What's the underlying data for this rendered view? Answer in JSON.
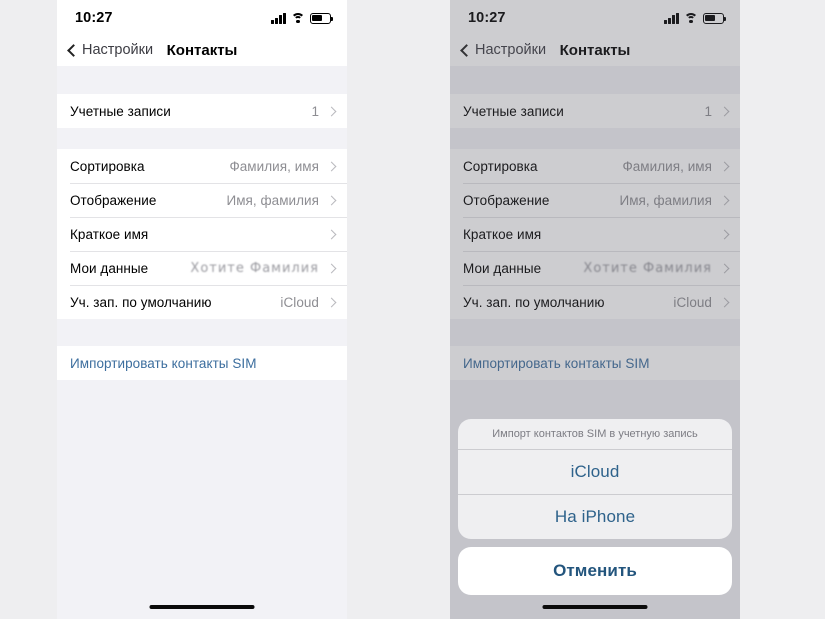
{
  "panels": [
    {
      "id": "left",
      "dimmed": false,
      "status_bar": {
        "time": "10:27",
        "signal_icon": "cellular-signal-icon",
        "wifi_icon": "wifi-icon",
        "battery_icon": "battery-icon"
      },
      "nav": {
        "back_label": "Настройки",
        "back_icon": "chevron-left-icon",
        "title": "Контакты"
      },
      "groups": [
        {
          "rows": [
            {
              "label": "Учетные записи",
              "value": "1",
              "type": "disclosure"
            }
          ]
        },
        {
          "rows": [
            {
              "label": "Сортировка",
              "value": "Фамилия, имя",
              "type": "disclosure"
            },
            {
              "label": "Отображение",
              "value": "Имя, фамилия",
              "type": "disclosure"
            },
            {
              "label": "Краткое имя",
              "value": "",
              "type": "disclosure"
            },
            {
              "label": "Мои данные",
              "value": "Хотите Фамилия",
              "type": "redacted"
            },
            {
              "label": "Уч. зап. по умолчанию",
              "value": "iCloud",
              "type": "disclosure"
            }
          ]
        },
        {
          "rows": [
            {
              "label": "Импортировать контакты SIM",
              "value": "",
              "type": "action"
            }
          ]
        }
      ],
      "home_indicator": "home-indicator"
    },
    {
      "id": "right",
      "dimmed": true,
      "status_bar": {
        "time": "10:27",
        "signal_icon": "cellular-signal-icon",
        "wifi_icon": "wifi-icon",
        "battery_icon": "battery-icon"
      },
      "nav": {
        "back_label": "Настройки",
        "back_icon": "chevron-left-icon",
        "title": "Контакты"
      },
      "groups": [
        {
          "rows": [
            {
              "label": "Учетные записи",
              "value": "1",
              "type": "disclosure"
            }
          ]
        },
        {
          "rows": [
            {
              "label": "Сортировка",
              "value": "Фамилия, имя",
              "type": "disclosure"
            },
            {
              "label": "Отображение",
              "value": "Имя, фамилия",
              "type": "disclosure"
            },
            {
              "label": "Краткое имя",
              "value": "",
              "type": "disclosure"
            },
            {
              "label": "Мои данные",
              "value": "Хотите Фамилия",
              "type": "redacted"
            },
            {
              "label": "Уч. зап. по умолчанию",
              "value": "iCloud",
              "type": "disclosure"
            }
          ]
        },
        {
          "rows": [
            {
              "label": "Импортировать контакты SIM",
              "value": "",
              "type": "action"
            }
          ]
        }
      ],
      "action_sheet": {
        "title": "Импорт контактов SIM в учетную запись",
        "options": [
          {
            "label": "iCloud"
          },
          {
            "label": "На iPhone"
          }
        ],
        "cancel_label": "Отменить"
      },
      "home_indicator": "home-indicator"
    }
  ],
  "colors": {
    "page_background": "#eeeef0",
    "group_background": "#f2f2f6",
    "row_background": "#ffffff",
    "accent_link": "#3c6e9e",
    "sheet_accent": "#2e628b",
    "secondary_text": "#8e8e93",
    "dim_overlay": "rgba(90,90,98,0.30)"
  }
}
